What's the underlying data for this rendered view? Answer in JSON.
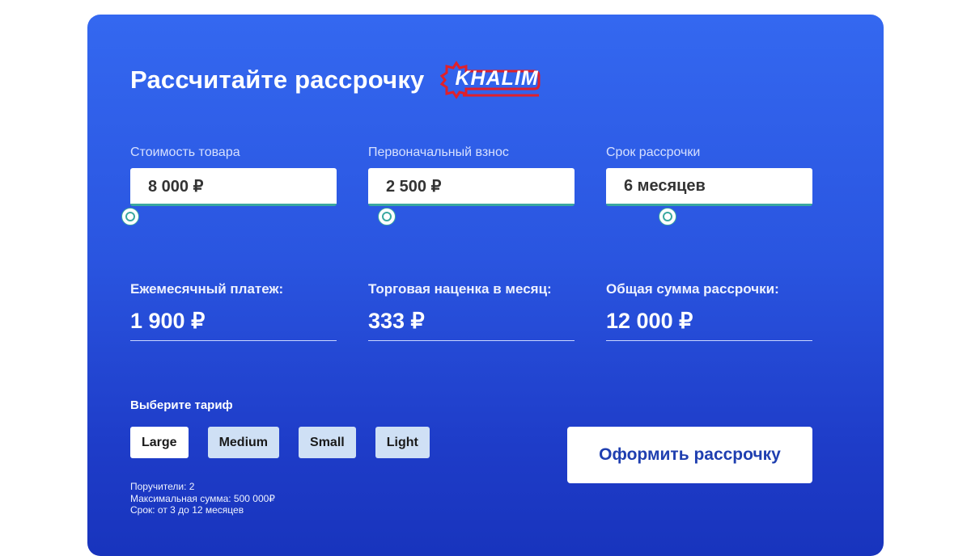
{
  "header": {
    "title": "Рассчитайте рассрочку",
    "logo_text": "KHALIM"
  },
  "inputs": [
    {
      "label": "Стоимость товара",
      "value": "8 000 ₽",
      "slider_level": 0.0
    },
    {
      "label": "Первоначальный взнос",
      "value": "2 500 ₽",
      "slider_level": 0.07
    },
    {
      "label": "Срок рассрочки",
      "value": "6 месяцев",
      "slider_level": 0.3
    }
  ],
  "results": [
    {
      "label": "Ежемесячный платеж:",
      "value": "1 900 ₽"
    },
    {
      "label": "Торговая наценка в месяц:",
      "value": "333 ₽"
    },
    {
      "label": "Общая сумма рассрочки:",
      "value": "12 000 ₽"
    }
  ],
  "tariff": {
    "label": "Выберите тариф",
    "options": [
      "Large",
      "Medium",
      "Small",
      "Light"
    ],
    "selected": "Large",
    "info": [
      "Поручители: 2",
      "Максимальная сумма: 500 000₽",
      "Срок: от 3 до 12 месяцев"
    ]
  },
  "submit_label": "Оформить рассрочку",
  "colors": {
    "card_top": "#3468f0",
    "card_bottom": "#1834bd",
    "accent_teal": "#3aa8a0",
    "logo_red": "#e0202a",
    "button_text": "#1f3fb0"
  }
}
